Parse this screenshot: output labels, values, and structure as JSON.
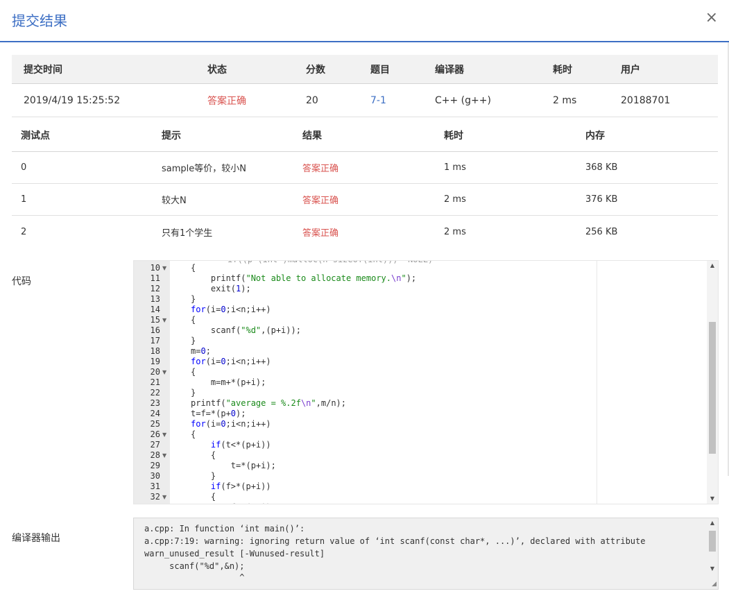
{
  "modal": {
    "title": "提交结果",
    "close_label": "×"
  },
  "summary": {
    "headers": [
      "提交时间",
      "状态",
      "分数",
      "题目",
      "编译器",
      "耗时",
      "用户"
    ],
    "row": {
      "time": "2019/4/19 15:25:52",
      "status": "答案正确",
      "score": "20",
      "problem": "7-1",
      "compiler": "C++ (g++)",
      "duration": "2 ms",
      "user": "20188701"
    }
  },
  "tests": {
    "headers": [
      "测试点",
      "提示",
      "结果",
      "耗时",
      "内存"
    ],
    "rows": [
      {
        "id": "0",
        "hint": "sample等价，较小N",
        "result": "答案正确",
        "time": "1 ms",
        "memory": "368 KB"
      },
      {
        "id": "1",
        "hint": "较大N",
        "result": "答案正确",
        "time": "2 ms",
        "memory": "376 KB"
      },
      {
        "id": "2",
        "hint": "只有1个学生",
        "result": "答案正确",
        "time": "2 ms",
        "memory": "256 KB"
      }
    ]
  },
  "code": {
    "label": "代码",
    "lines": [
      {
        "n": "10",
        "fold": true
      },
      {
        "n": "11"
      },
      {
        "n": "12"
      },
      {
        "n": "13"
      },
      {
        "n": "14"
      },
      {
        "n": "15",
        "fold": true
      },
      {
        "n": "16"
      },
      {
        "n": "17"
      },
      {
        "n": "18"
      },
      {
        "n": "19"
      },
      {
        "n": "20",
        "fold": true
      },
      {
        "n": "21"
      },
      {
        "n": "22"
      },
      {
        "n": "23"
      },
      {
        "n": "24"
      },
      {
        "n": "25"
      },
      {
        "n": "26",
        "fold": true
      },
      {
        "n": "27"
      },
      {
        "n": "28",
        "fold": true
      },
      {
        "n": "29"
      },
      {
        "n": "30"
      },
      {
        "n": "31"
      },
      {
        "n": "32",
        "fold": true
      }
    ]
  },
  "compiler_output": {
    "label": "编译器输出",
    "lines": [
      "a.cpp: In function ‘int main()’:",
      "a.cpp:7:19: warning: ignoring return value of ‘int scanf(const char*, ...)’, declared with attribute",
      "warn_unused_result [-Wunused-result]",
      "     scanf(\"%d\",&n);",
      "                   ^"
    ]
  },
  "colors": {
    "accent": "#3d6fc4",
    "status_ok": "#d9534f"
  }
}
